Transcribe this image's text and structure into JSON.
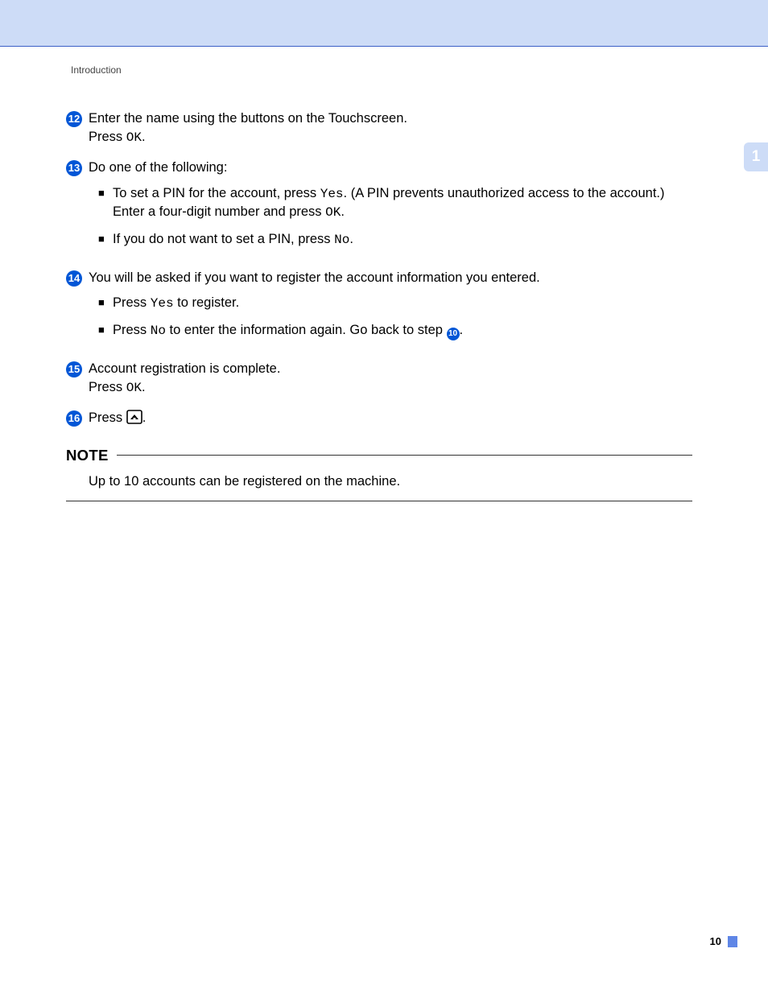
{
  "header": {
    "section": "Introduction"
  },
  "side_tab": "1",
  "steps": {
    "s12": {
      "num": "12",
      "line1": "Enter the name using the buttons on the Touchscreen.",
      "line2a": "Press ",
      "line2b": "OK",
      "line2c": "."
    },
    "s13": {
      "num": "13",
      "intro": "Do one of the following:",
      "b1a": "To set a PIN for the account, press ",
      "b1b": "Yes",
      "b1c": ". (A PIN prevents unauthorized access to the account.) Enter a four-digit number and press ",
      "b1d": "OK",
      "b1e": ".",
      "b2a": "If you do not want to set a PIN, press ",
      "b2b": "No",
      "b2c": "."
    },
    "s14": {
      "num": "14",
      "intro": "You will be asked if you want to register the account information you entered.",
      "b1a": "Press ",
      "b1b": "Yes",
      "b1c": " to register.",
      "b2a": "Press ",
      "b2b": "No",
      "b2c": " to enter the information again. Go back to step ",
      "b2ref": "10",
      "b2d": "."
    },
    "s15": {
      "num": "15",
      "line1": "Account registration is complete.",
      "line2a": "Press ",
      "line2b": "OK",
      "line2c": "."
    },
    "s16": {
      "num": "16",
      "line1a": "Press ",
      "line1b": "."
    }
  },
  "note": {
    "label": "NOTE",
    "body": "Up to 10 accounts can be registered on the machine."
  },
  "footer": {
    "page": "10"
  }
}
